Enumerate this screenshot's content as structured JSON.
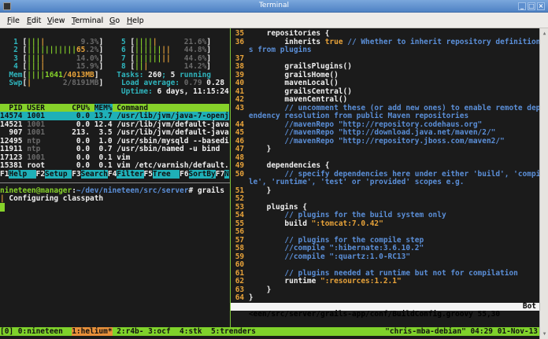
{
  "window": {
    "title": "Terminal",
    "buttons": [
      "minimize",
      "maximize",
      "close"
    ]
  },
  "menu": [
    {
      "label": "File",
      "u": "F",
      "rest": "ile"
    },
    {
      "label": "Edit",
      "u": "E",
      "rest": "dit"
    },
    {
      "label": "View",
      "u": "V",
      "rest": "iew"
    },
    {
      "label": "Terminal",
      "u": "T",
      "rest": "erminal"
    },
    {
      "label": "Go",
      "u": "G",
      "rest": "o"
    },
    {
      "label": "Help",
      "u": "H",
      "rest": "elp"
    }
  ],
  "left_pane": {
    "rows": [
      [],
      [
        [
          "   1 ",
          "cyan"
        ],
        [
          "[",
          "wb"
        ],
        [
          "|||",
          "green"
        ],
        [
          "|",
          "orange"
        ],
        [
          "        9.3%",
          "gray"
        ],
        [
          "]",
          "wb"
        ],
        [
          "    5 ",
          "cyan"
        ],
        [
          "[",
          "wb"
        ],
        [
          "||||",
          "green"
        ],
        [
          "|",
          "orange"
        ],
        [
          "      21.6%",
          "gray"
        ],
        [
          "]",
          "wb"
        ]
      ],
      [
        [
          "   2 ",
          "cyan"
        ],
        [
          "[",
          "wb"
        ],
        [
          "|||||||||||",
          "green"
        ],
        [
          "65",
          "orange"
        ],
        [
          ".2%",
          "gray"
        ],
        [
          "]",
          "wb"
        ],
        [
          "    6 ",
          "cyan"
        ],
        [
          "[",
          "wb"
        ],
        [
          "||||||",
          "green"
        ],
        [
          "||",
          "orange"
        ],
        [
          "   44.8%",
          "gray"
        ],
        [
          "]",
          "wb"
        ]
      ],
      [
        [
          "   3 ",
          "cyan"
        ],
        [
          "[",
          "wb"
        ],
        [
          "|||",
          "green"
        ],
        [
          "|",
          "orange"
        ],
        [
          "       14.0%",
          "gray"
        ],
        [
          "]",
          "wb"
        ],
        [
          "    7 ",
          "cyan"
        ],
        [
          "[",
          "wb"
        ],
        [
          "||||||",
          "green"
        ],
        [
          "||",
          "orange"
        ],
        [
          "   44.6%",
          "gray"
        ],
        [
          "]",
          "wb"
        ]
      ],
      [
        [
          "   4 ",
          "cyan"
        ],
        [
          "[",
          "wb"
        ],
        [
          "|||",
          "green"
        ],
        [
          "|",
          "orange"
        ],
        [
          "       15.9%",
          "gray"
        ],
        [
          "]",
          "wb"
        ],
        [
          "    8 ",
          "cyan"
        ],
        [
          "[",
          "wb"
        ],
        [
          "||",
          "green"
        ],
        [
          "|",
          "orange"
        ],
        [
          "        14.2%",
          "gray"
        ],
        [
          "]",
          "wb"
        ]
      ],
      [
        [
          "  Mem",
          "cyan"
        ],
        [
          "[",
          "wb"
        ],
        [
          "||||",
          "green"
        ],
        [
          "1641",
          "green"
        ],
        [
          "/4013MB",
          "orange"
        ],
        [
          "]",
          "wb"
        ],
        [
          "    Tasks: ",
          "cyan"
        ],
        [
          "260",
          "wb"
        ],
        [
          ";",
          "cyan"
        ],
        [
          " 5 ",
          "wb"
        ],
        [
          "running",
          "cyan"
        ]
      ],
      [
        [
          "  Swp",
          "cyan"
        ],
        [
          "[",
          "wb"
        ],
        [
          "|",
          "orange"
        ],
        [
          "       2/8191MB",
          "gray"
        ],
        [
          "]",
          "wb"
        ],
        [
          "    Load average: ",
          "cyan"
        ],
        [
          "0.79 ",
          "gray"
        ],
        [
          "0.28",
          "wb"
        ]
      ],
      [
        [
          "                       ",
          ""
        ],
        [
          "    Uptime: ",
          "cyan"
        ],
        [
          "6 days, 11:15:24",
          "wb"
        ]
      ],
      [],
      [
        [
          "  PID USER      CPU% ",
          "hdr"
        ],
        [
          "MEM%",
          "hdrsel"
        ],
        [
          " Command                  ",
          "hdr"
        ]
      ],
      [
        [
          "14574 1001       0.0 13.7 /usr/lib/jvm/java-7-openj",
          "sel"
        ]
      ],
      [
        [
          "14521 ",
          "wb"
        ],
        [
          "1001",
          "gray"
        ],
        [
          "       0.0 12.4 /usr/lib/jvm/default-java",
          "wb"
        ]
      ],
      [
        [
          "  907 ",
          "wb"
        ],
        [
          "1001",
          "gray"
        ],
        [
          "      213.  3.5 /usr/lib/jvm/default-java",
          "wb"
        ]
      ],
      [
        [
          "12495 ",
          "wb"
        ],
        [
          "ntp ",
          "gray"
        ],
        [
          "       0.0  1.0 /usr/sbin/mysqld --basedi",
          "wb"
        ]
      ],
      [
        [
          "11911 ",
          "wb"
        ],
        [
          "ntp ",
          "gray"
        ],
        [
          "       0.0  0.7 /usr/sbin/named -u bind",
          "wb"
        ]
      ],
      [
        [
          "17123 ",
          "wb"
        ],
        [
          "1001",
          "gray"
        ],
        [
          "       0.0  0.1 vim",
          "wb"
        ]
      ],
      [
        [
          "15381 root       0.0  0.1 vim /etc/varnish/default.",
          "wb"
        ]
      ],
      [
        [
          "F1",
          "wb"
        ],
        [
          "Help  ",
          "fkl"
        ],
        [
          "F2",
          "wb"
        ],
        [
          "Setup ",
          "fkl"
        ],
        [
          "F3",
          "wb"
        ],
        [
          "Search",
          "fkl"
        ],
        [
          "F4",
          "wb"
        ],
        [
          "Filter",
          "fkl"
        ],
        [
          "F5",
          "wb"
        ],
        [
          "Tree  ",
          "fkl"
        ],
        [
          "F6",
          "wb"
        ],
        [
          "SortBy",
          "fkl"
        ],
        [
          "F7",
          "wb"
        ],
        [
          "N",
          "fkl"
        ]
      ],
      [],
      [
        [
          "nineteen@manager",
          "green"
        ],
        [
          ":",
          "wb"
        ],
        [
          "~/dev/nineteen/src/server",
          "blue"
        ],
        [
          "# grails",
          "wb"
        ]
      ],
      [
        [
          "|",
          "orange"
        ],
        [
          " Configuring classpath",
          "wb"
        ]
      ],
      [
        [
          " ",
          "cursor"
        ]
      ]
    ]
  },
  "right_pane": {
    "rows": [
      [
        [
          " 35 ",
          "lnum"
        ],
        [
          "    repositories {",
          "wb"
        ]
      ],
      [
        [
          " 36 ",
          "lnum"
        ],
        [
          "        inherits ",
          "wb"
        ],
        [
          "true",
          "orange"
        ],
        [
          " // Whether to inherit repository definition",
          "cmt"
        ]
      ],
      [
        [
          "    ",
          ""
        ],
        [
          "s from plugins",
          "cmt"
        ]
      ],
      [
        [
          " 37 ",
          "lnum"
        ]
      ],
      [
        [
          " 38 ",
          "lnum"
        ],
        [
          "        grailsPlugins()",
          "wb"
        ]
      ],
      [
        [
          " 39 ",
          "lnum"
        ],
        [
          "        grailsHome()",
          "wb"
        ]
      ],
      [
        [
          " 40 ",
          "lnum"
        ],
        [
          "        mavenLocal()",
          "wb"
        ]
      ],
      [
        [
          " 41 ",
          "lnum"
        ],
        [
          "        grailsCentral()",
          "wb"
        ]
      ],
      [
        [
          " 42 ",
          "lnum"
        ],
        [
          "        mavenCentral()",
          "wb"
        ]
      ],
      [
        [
          " 43 ",
          "lnum"
        ],
        [
          "        // uncomment these (or add new ones) to enable remote dep",
          "cmt"
        ]
      ],
      [
        [
          "    ",
          ""
        ],
        [
          "endency resolution from public Maven repositories",
          "cmt"
        ]
      ],
      [
        [
          " 44 ",
          "lnum"
        ],
        [
          "        //mavenRepo \"http://repository.codehaus.org\"",
          "cmt"
        ]
      ],
      [
        [
          " 45 ",
          "lnum"
        ],
        [
          "        //mavenRepo \"http://download.java.net/maven/2/\"",
          "cmt"
        ]
      ],
      [
        [
          " 46 ",
          "lnum"
        ],
        [
          "        //mavenRepo \"http://repository.jboss.com/maven2/\"",
          "cmt"
        ]
      ],
      [
        [
          " 47 ",
          "lnum"
        ],
        [
          "    }",
          "wb"
        ]
      ],
      [
        [
          " 48 ",
          "lnum"
        ]
      ],
      [
        [
          " 49 ",
          "lnum"
        ],
        [
          "    dependencies {",
          "wb"
        ]
      ],
      [
        [
          " 50 ",
          "lnum"
        ],
        [
          "        // specify dependencies here under either 'build', 'compi",
          "cmt"
        ]
      ],
      [
        [
          "    ",
          ""
        ],
        [
          "le', 'runtime', 'test' or 'provided' scopes e.g.",
          "cmt"
        ]
      ],
      [
        [
          " 51 ",
          "lnum"
        ],
        [
          "    }",
          "wb"
        ]
      ],
      [
        [
          " 52 ",
          "lnum"
        ]
      ],
      [
        [
          " 53 ",
          "lnum"
        ],
        [
          "    plugins {",
          "wb"
        ]
      ],
      [
        [
          " 54 ",
          "lnum"
        ],
        [
          "        // plugins for the build system only",
          "cmt"
        ]
      ],
      [
        [
          " 55 ",
          "lnum"
        ],
        [
          "        build ",
          "wb"
        ],
        [
          "\":tomcat:7.0.42\"",
          "str"
        ]
      ],
      [
        [
          " 56 ",
          "lnum"
        ]
      ],
      [
        [
          " 57 ",
          "lnum"
        ],
        [
          "        // plugins for the compile step",
          "cmt"
        ]
      ],
      [
        [
          " 58 ",
          "lnum"
        ],
        [
          "        //compile \":hibernate:3.6.10.2\"",
          "cmt"
        ]
      ],
      [
        [
          " 59 ",
          "lnum"
        ],
        [
          "        //compile \":quartz:1.0-RC13\"",
          "cmt"
        ]
      ],
      [
        [
          " 60 ",
          "lnum"
        ]
      ],
      [
        [
          " 61 ",
          "lnum"
        ],
        [
          "        // plugins needed at runtime but not for compilation",
          "cmt"
        ]
      ],
      [
        [
          " 62 ",
          "lnum"
        ],
        [
          "        runtime ",
          "wb"
        ],
        [
          "\":resources:1.2.1\"",
          "str"
        ]
      ],
      [
        [
          " 63 ",
          "lnum"
        ],
        [
          "    }",
          "wb"
        ]
      ],
      [
        [
          " 64 ",
          "lnum"
        ],
        [
          "}",
          "wb"
        ]
      ]
    ]
  },
  "vim_status": {
    "file": "<een/src/server/grails-app/conf/BuildConfig.groovy 55,30",
    "position": "Bot"
  },
  "tmux": {
    "session": "[0] 0:nineteen  ",
    "active_window": "1:helium*",
    "windows": " 2:r4b- 3:ocf  4:stk  5:trenders",
    "right": "\"chris-mba-debian\" 04:29 01-Nov-13"
  }
}
